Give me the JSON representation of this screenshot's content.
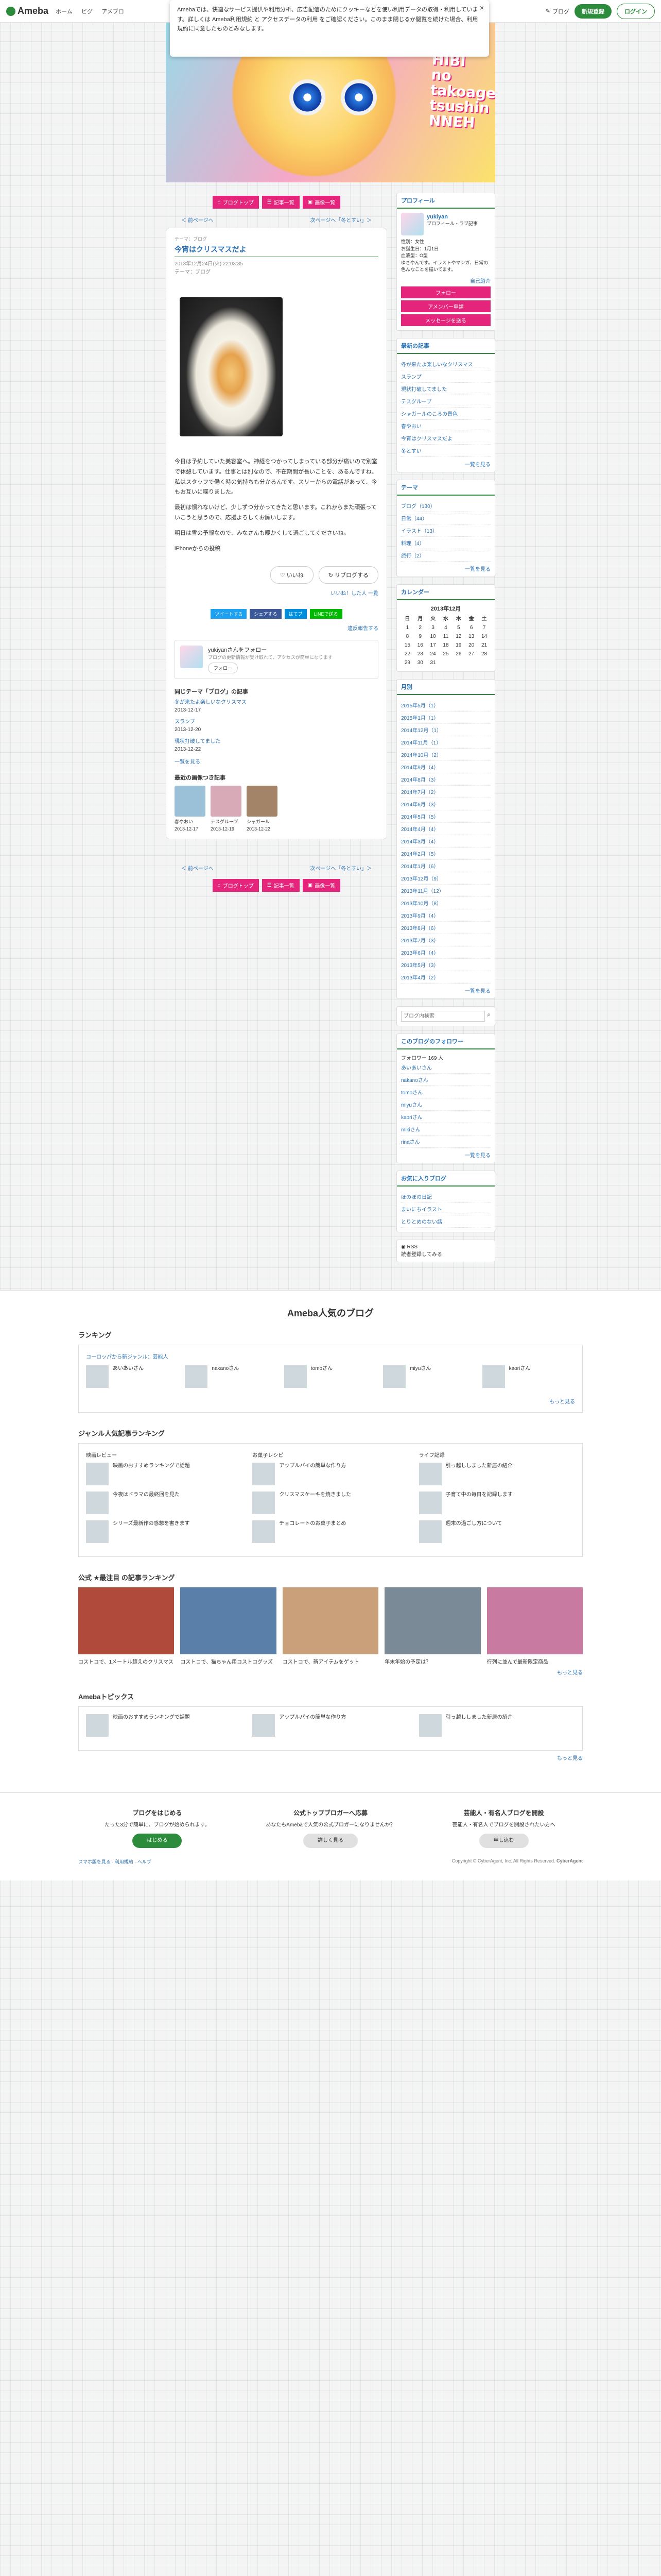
{
  "topbar": {
    "logo": "Ameba",
    "nav": [
      "ホーム",
      "ピグ",
      "アメブロ"
    ],
    "blog_btn": "ブログ",
    "register": "新規登録",
    "login": "ログイン"
  },
  "cookie": {
    "text": "Amebaでは、快適なサービス提供や利用分析、広告配信のためにクッキーなどを使い利用データの取得・利用しています。詳しくは Ameba利用規約 と アクセスデータの利用 をご確認ください。このまま閉じるか閲覧を続けた場合、利用規約に同意したものとみなします。",
    "close": "×"
  },
  "banner": {
    "title": "HIBI no takoage tsushin NNEH"
  },
  "tabs": [
    "ブログトップ",
    "記事一覧",
    "画像一覧"
  ],
  "pager": {
    "prev": "＜ 前ページへ",
    "next": "次ページへ「冬とすい」＞"
  },
  "article": {
    "theme_label": "テーマ：ブログ",
    "title": "今宵はクリスマスだよ",
    "date": "2013年12月24日(火) 22:03:35",
    "theme": "テーマ：ブログ",
    "paragraphs": [
      "今日は予約していた美容室へ。神経をつかってしまっている部分が痛いので別室で休憩しています。仕事とは別なので、不在期間が長いことを、あるんですね。私はスタッフで働く時の気持ちも分かるんです。スリーからの電話があって、今もお互いに喋りました。",
      "最初は慣れないけど、少しずつ分かってきたと思います。これからまた頑張っていこうと思うので、応援よろしくお願いします。",
      "明日は雪の予報なので、みなさんも暖かくして過ごしてくださいね。",
      "iPhoneからの投稿"
    ],
    "like": "いいね",
    "reblog": "リブログする",
    "like_small": "いいね！した人 一覧",
    "share": [
      "ツイートする",
      "シェアする",
      "はてブ",
      "LINEで送る"
    ],
    "report": "違反報告する"
  },
  "profile_box": {
    "name": "yukiyanさんをフォロー",
    "desc": "ブログの更新情報が受け取れて、アクセスが簡単になります",
    "follow": "フォロー"
  },
  "same_theme": {
    "heading": "同じテーマ「ブログ」の記事",
    "entries": [
      {
        "title": "冬が来たよ楽しいなクリスマス",
        "date": "2013-12-17"
      },
      {
        "title": "スランプ",
        "date": "2013-12-20"
      },
      {
        "title": "現状打破してました",
        "date": "2013-12-22"
      }
    ],
    "more": "一覧を見る"
  },
  "recent": {
    "heading": "最近の画像つき記事",
    "items": [
      {
        "title": "春やおい",
        "date": "2013-12-17"
      },
      {
        "title": "テスグループ",
        "date": "2013-12-19"
      },
      {
        "title": "シャガール",
        "date": "2013-12-22"
      }
    ]
  },
  "sidebar": {
    "profile": {
      "title": "プロフィール",
      "name": "yukiyan",
      "label": "プロフィール・ラブ記事",
      "sex": "性別：女性",
      "birthday": "お誕生日：1月1日",
      "blood": "血液型：O型",
      "intro": "ゆきやんです。イラストやマンガ、日常の色んなことを描いてます。",
      "read_more": "自己紹介",
      "follow": "フォロー",
      "ameba_follow": "アメンバー申請",
      "message": "メッセージを送る"
    },
    "recent_title": "最新の記事",
    "recent_items": [
      "冬が来たよ楽しいなクリスマス",
      "スランプ",
      "現状打破してました",
      "テスグループ",
      "シャガールのころの景色",
      "春やおい",
      "今宵はクリスマスだよ",
      "冬とすい"
    ],
    "theme_title": "テーマ",
    "themes": [
      "ブログ（130）",
      "日常（44）",
      "イラスト（13）",
      "料理（4）",
      "旅行（2）"
    ],
    "calendar_title": "カレンダー",
    "cal_month": "2013年12月",
    "cal_head": [
      "日",
      "月",
      "火",
      "水",
      "木",
      "金",
      "土"
    ],
    "cal_rows": [
      [
        "1",
        "2",
        "3",
        "4",
        "5",
        "6",
        "7"
      ],
      [
        "8",
        "9",
        "10",
        "11",
        "12",
        "13",
        "14"
      ],
      [
        "15",
        "16",
        "17",
        "18",
        "19",
        "20",
        "21"
      ],
      [
        "22",
        "23",
        "24",
        "25",
        "26",
        "27",
        "28"
      ],
      [
        "29",
        "30",
        "31",
        "",
        "",
        "",
        ""
      ]
    ],
    "archive_title": "月別",
    "archives": [
      "2015年5月（1）",
      "2015年1月（1）",
      "2014年12月（1）",
      "2014年11月（1）",
      "2014年10月（2）",
      "2014年9月（4）",
      "2014年8月（3）",
      "2014年7月（2）",
      "2014年6月（3）",
      "2014年5月（5）",
      "2014年4月（4）",
      "2014年3月（4）",
      "2014年2月（5）",
      "2014年1月（6）",
      "2013年12月（9）",
      "2013年11月（12）",
      "2013年10月（8）",
      "2013年9月（4）",
      "2013年8月（6）",
      "2013年7月（3）",
      "2013年6月（4）",
      "2013年5月（3）",
      "2013年4月（2）"
    ],
    "more": "一覧を見る",
    "search_placeholder": "ブログ内検索",
    "followers_title": "このブログのフォロワー",
    "followers_count": "フォロワー 169 人",
    "followers": [
      "あいあいさん",
      "nakanoさん",
      "tomoさん",
      "miyuさん",
      "kaoriさん",
      "mikiさん",
      "rinaさん"
    ],
    "friends_title": "お気に入りブログ",
    "friends": [
      "ほのぼの日記",
      "まいにちイラスト",
      "とりとめのない話"
    ],
    "rss": "RSS",
    "rss_sub": "読者登録してみる"
  },
  "popular": {
    "heading": "Ameba人気のブログ",
    "ranking_title": "ランキング",
    "ranking_tab": "コーロッパから新ジャンル：芸能人",
    "genre_title": "ジャンル人気記事ランキング",
    "genre_cols": [
      {
        "name": "映画レビュー",
        "items": [
          "映画のおすすめランキングで話題",
          "今夜はドラマの最終回を見た",
          "シリーズ最新作の感想を書きます"
        ]
      },
      {
        "name": "お菓子レシピ",
        "items": [
          "アップルパイの簡単な作り方",
          "クリスマスケーキを焼きました",
          "チョコレートのお菓子まとめ"
        ]
      },
      {
        "name": "ライフ記録",
        "items": [
          "引っ越ししました新居の紹介",
          "子育て中の毎日を記録します",
          "週末の過ごし方について"
        ]
      }
    ],
    "official_title": "公式 ★最注目 の記事ランキング",
    "topics": [
      "コストコで、1メートル超えのクリスマス",
      "コストコで、猫ちゃん用コストコグッズ",
      "コストコで、新アイテムをゲット",
      "年末年始の予定は？",
      "行列に並んで最新限定商品"
    ],
    "topics2_title": "Amebaトピックス",
    "more": "もっと見る"
  },
  "footer": {
    "cols": [
      {
        "title": "ブログをはじめる",
        "text": "たった3分で簡単に、ブログが始められます。",
        "btn": "はじめる"
      },
      {
        "title": "公式トップブロガーへ応募",
        "text": "あなたもAmebaで人気の公式ブロガーになりませんか？",
        "btn": "詳しく見る"
      },
      {
        "title": "芸能人・有名人ブログを開設",
        "text": "芸能人・有名人でブログを開設されたい方へ",
        "btn": "申し込む"
      }
    ],
    "copyright": "Copyright © CyberAgent, Inc. All Rights Reserved.",
    "brand": "CyberAgent",
    "links": [
      "スマホ版を見る",
      "利用規約",
      "ヘルプ"
    ]
  }
}
